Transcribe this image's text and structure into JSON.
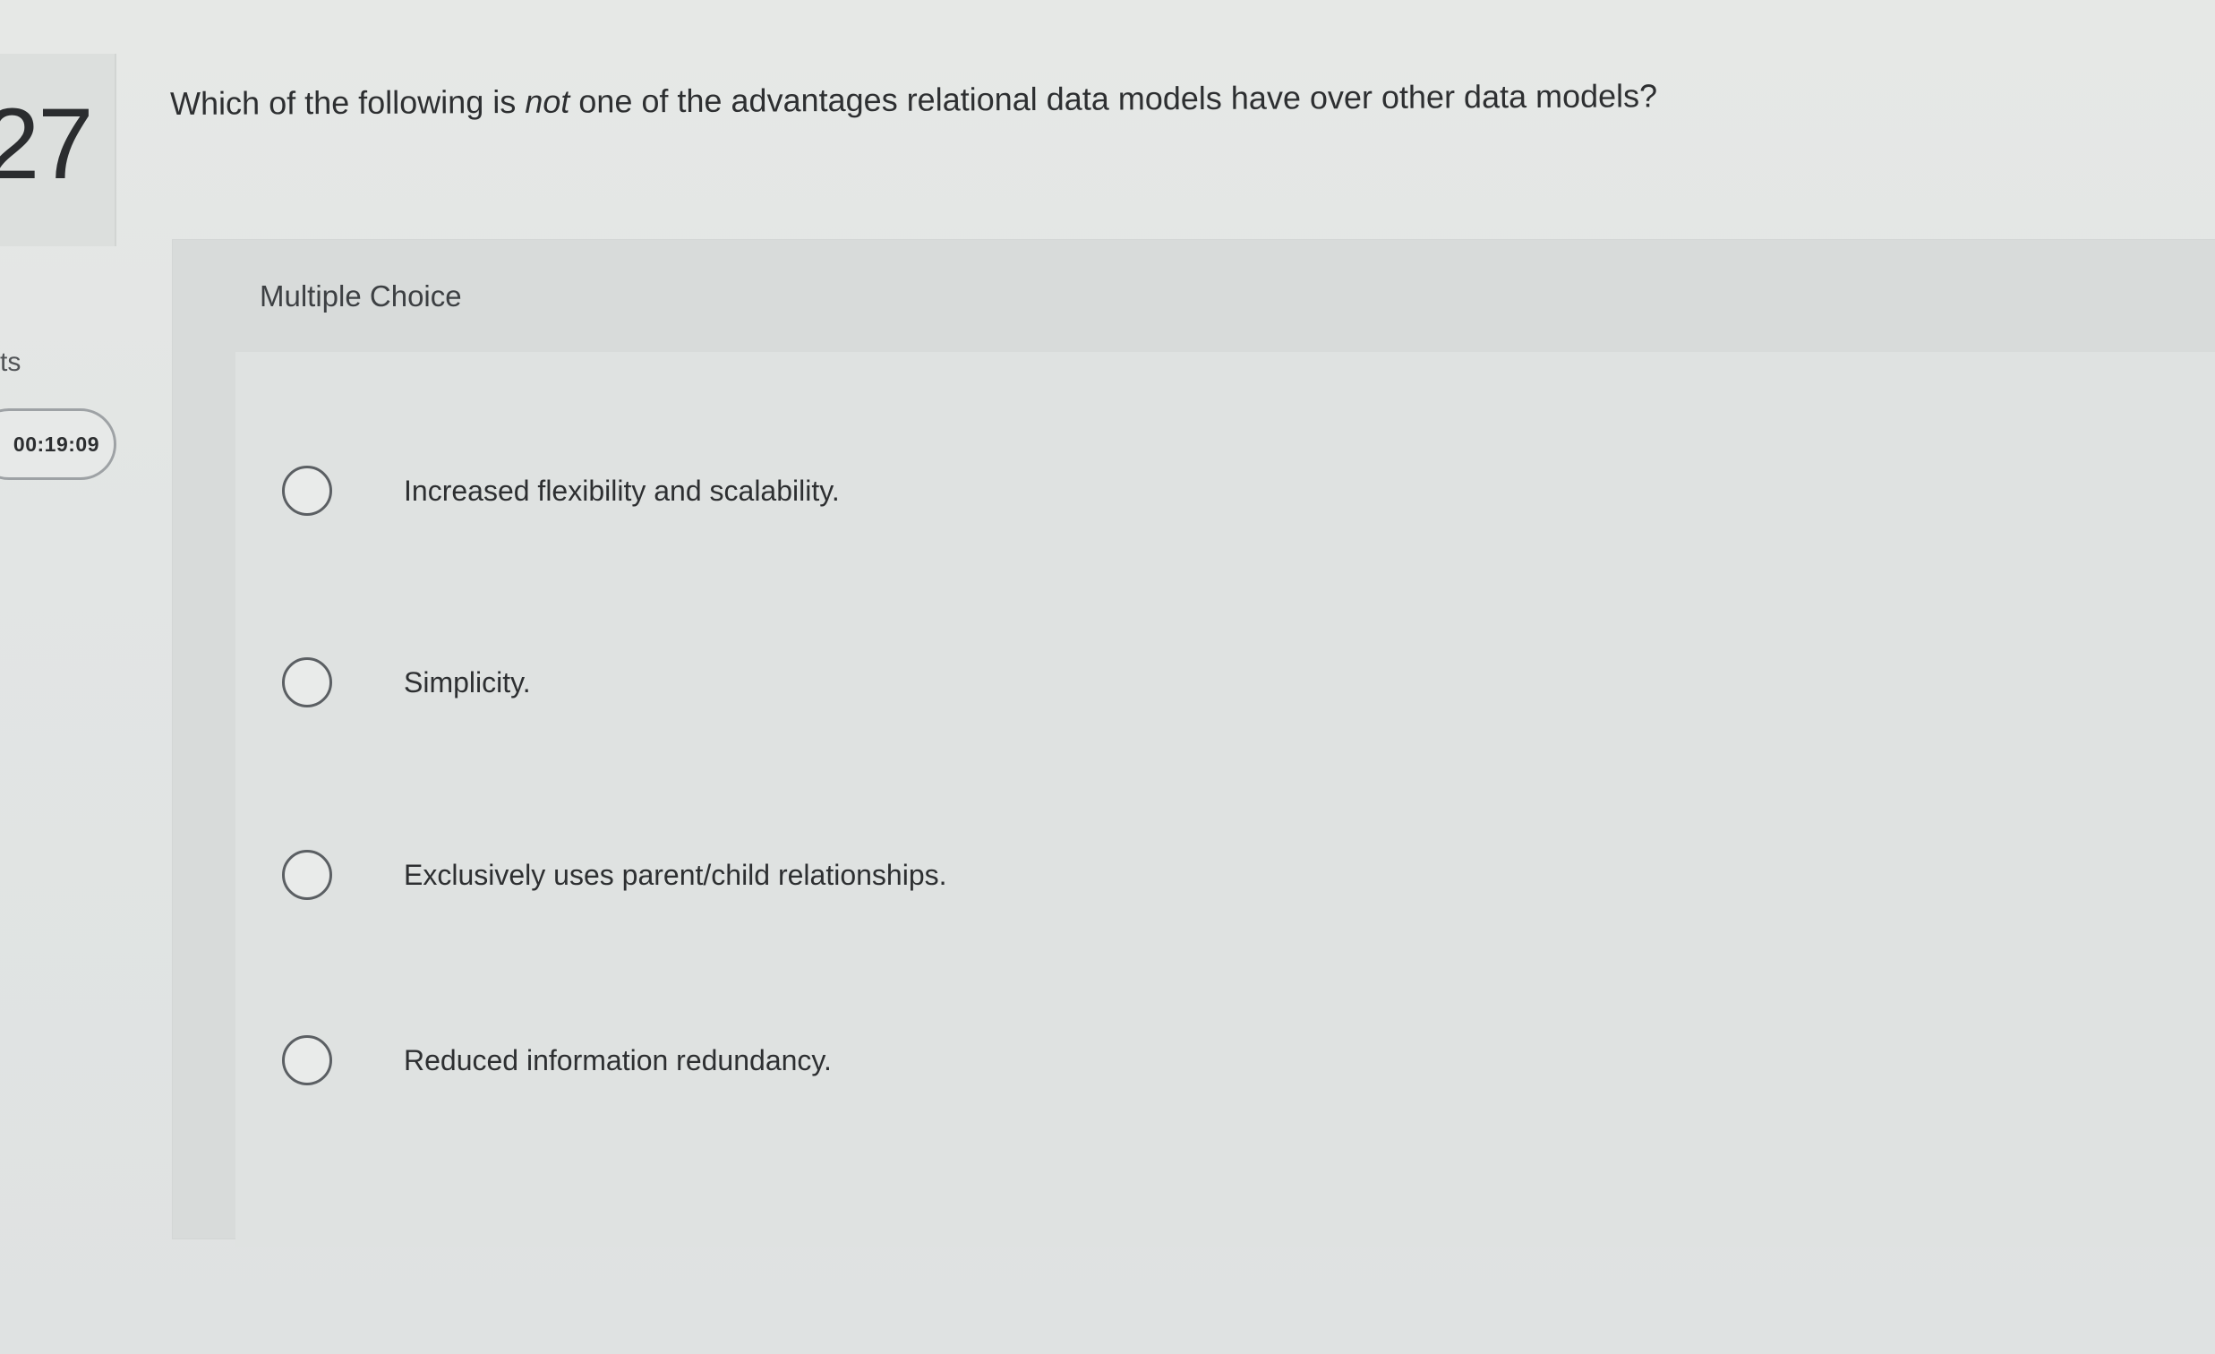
{
  "question": {
    "number": "27",
    "points_label": "ts",
    "timer": "00:19:09",
    "prompt_before": "Which of the following is ",
    "prompt_emphasis": "not",
    "prompt_after": " one of the advantages relational data models have over other data models?"
  },
  "answer_block": {
    "type_label": "Multiple Choice",
    "options": [
      {
        "label": "Increased flexibility and scalability.",
        "selected": false
      },
      {
        "label": "Simplicity.",
        "selected": false
      },
      {
        "label": "Exclusively uses parent/child relationships.",
        "selected": false
      },
      {
        "label": "Reduced information redundancy.",
        "selected": false
      }
    ]
  }
}
